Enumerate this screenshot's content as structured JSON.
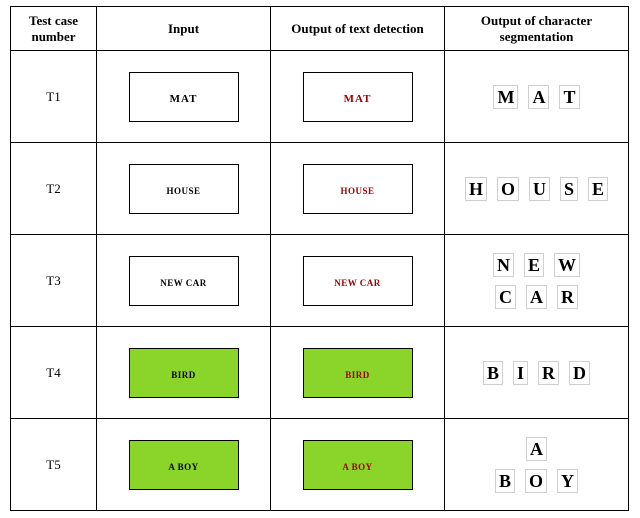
{
  "headers": {
    "c1": "Test case number",
    "c2": "Input",
    "c3": "Output of text detection",
    "c4": "Output of character segmentation"
  },
  "rows": [
    {
      "id": "T1",
      "green": false,
      "big": true,
      "input_label": "MAT",
      "detect_label": "MAT",
      "seg_lines": [
        [
          "M",
          "A",
          "T"
        ]
      ]
    },
    {
      "id": "T2",
      "green": false,
      "big": false,
      "input_label": "HOUSE",
      "detect_label": "HOUSE",
      "seg_lines": [
        [
          "H",
          "O",
          "U",
          "S",
          "E"
        ]
      ]
    },
    {
      "id": "T3",
      "green": false,
      "big": false,
      "input_label": "NEW CAR",
      "detect_label": "NEW CAR",
      "seg_lines": [
        [
          "N",
          "E",
          "W"
        ],
        [
          "C",
          "A",
          "R"
        ]
      ]
    },
    {
      "id": "T4",
      "green": true,
      "big": false,
      "input_label": "BIRD",
      "detect_label": "BIRD",
      "seg_lines": [
        [
          "B",
          "I",
          "R",
          "D"
        ]
      ]
    },
    {
      "id": "T5",
      "green": true,
      "big": false,
      "input_label": "A BOY",
      "detect_label": "A BOY",
      "seg_lines": [
        [
          "A"
        ],
        [
          "B",
          "O",
          "Y"
        ]
      ]
    }
  ]
}
